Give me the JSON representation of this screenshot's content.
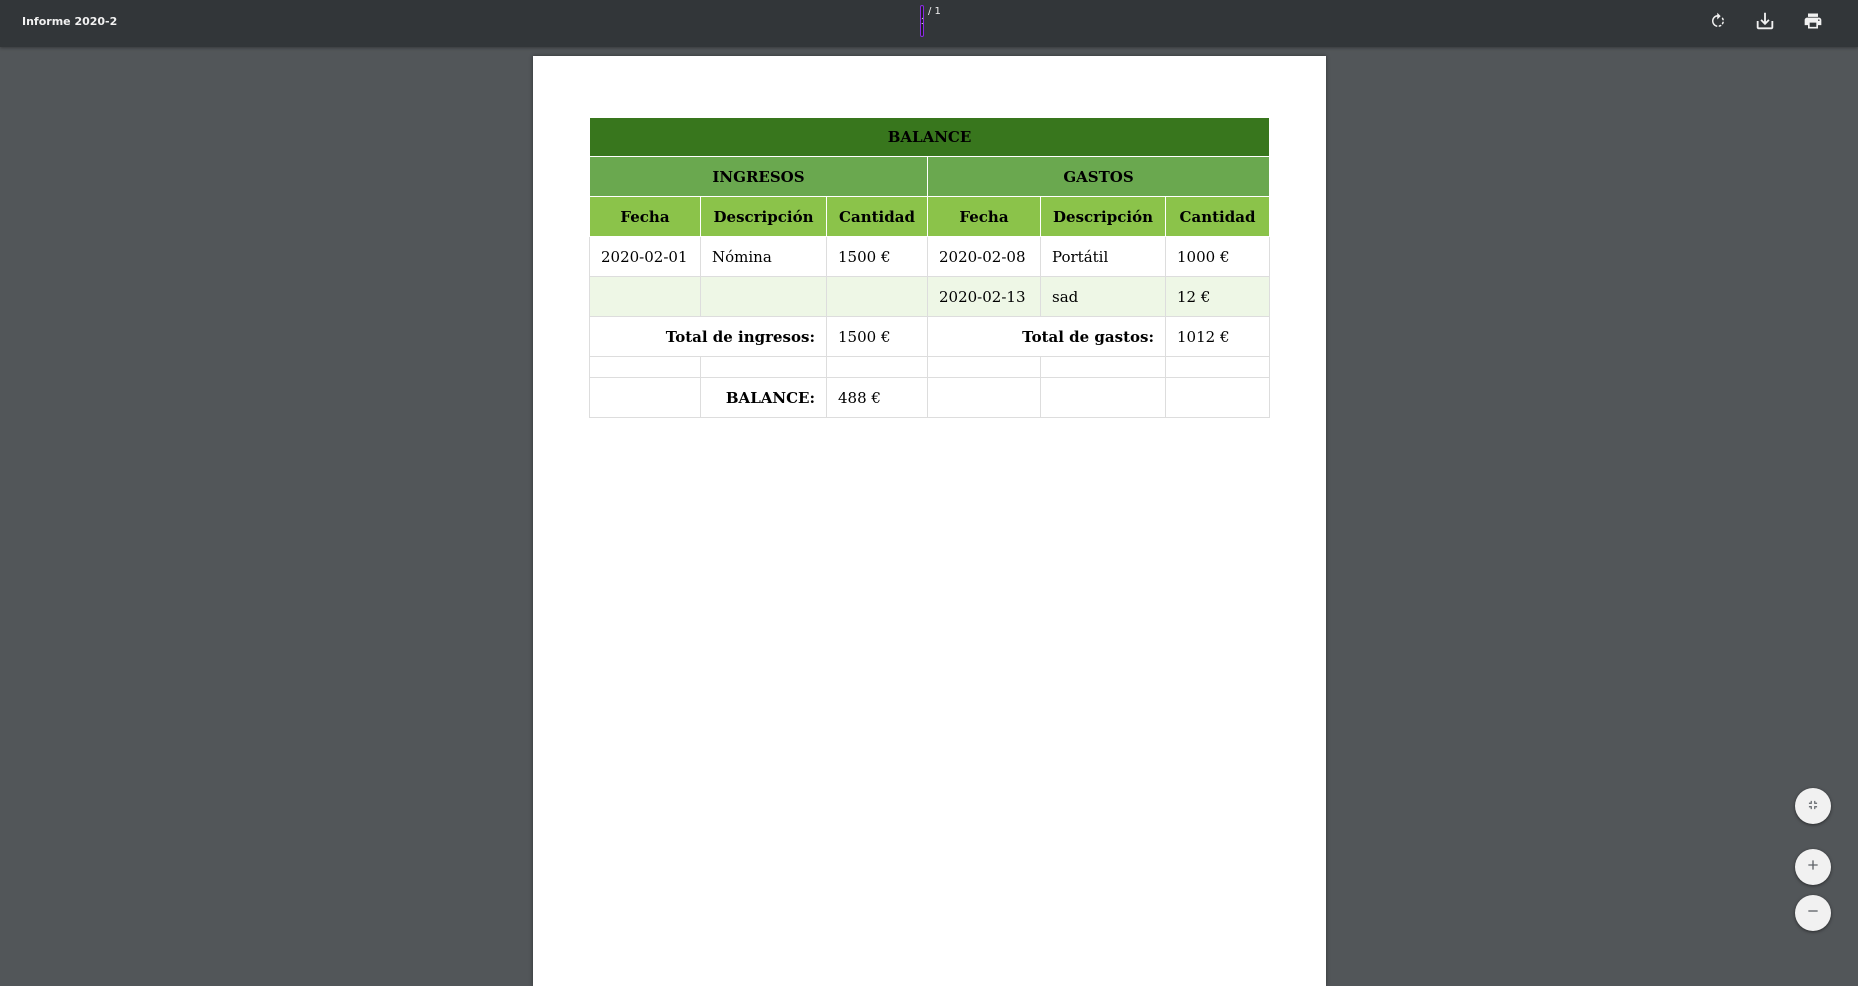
{
  "toolbar": {
    "title": "Informe 2020-2",
    "page_current": "1",
    "page_total": "/ 1",
    "rotate_icon": "rotate-icon",
    "download_icon": "download-icon",
    "print_icon": "print-icon"
  },
  "report": {
    "balance_title": "BALANCE",
    "income_header": "INGRESOS",
    "expense_header": "GASTOS",
    "col_date": "Fecha",
    "col_desc": "Descripción",
    "col_amount": "Cantidad",
    "rows": [
      {
        "in_date": "2020-02-01",
        "in_desc": "Nómina",
        "in_amount": "1500 €",
        "out_date": "2020-02-08",
        "out_desc": "Portátil",
        "out_amount": "1000 €"
      },
      {
        "in_date": "",
        "in_desc": "",
        "in_amount": "",
        "out_date": "2020-02-13",
        "out_desc": "sad",
        "out_amount": "12 €"
      }
    ],
    "total_income_label": "Total de ingresos:",
    "total_income_value": "1500 €",
    "total_expense_label": "Total de gastos:",
    "total_expense_value": "1012 €",
    "balance_label": "BALANCE:",
    "balance_value": "488 €"
  },
  "controls": {
    "fit_icon": "fit-page-icon",
    "zoom_in_icon": "zoom-in-icon",
    "zoom_out_icon": "zoom-out-icon"
  }
}
